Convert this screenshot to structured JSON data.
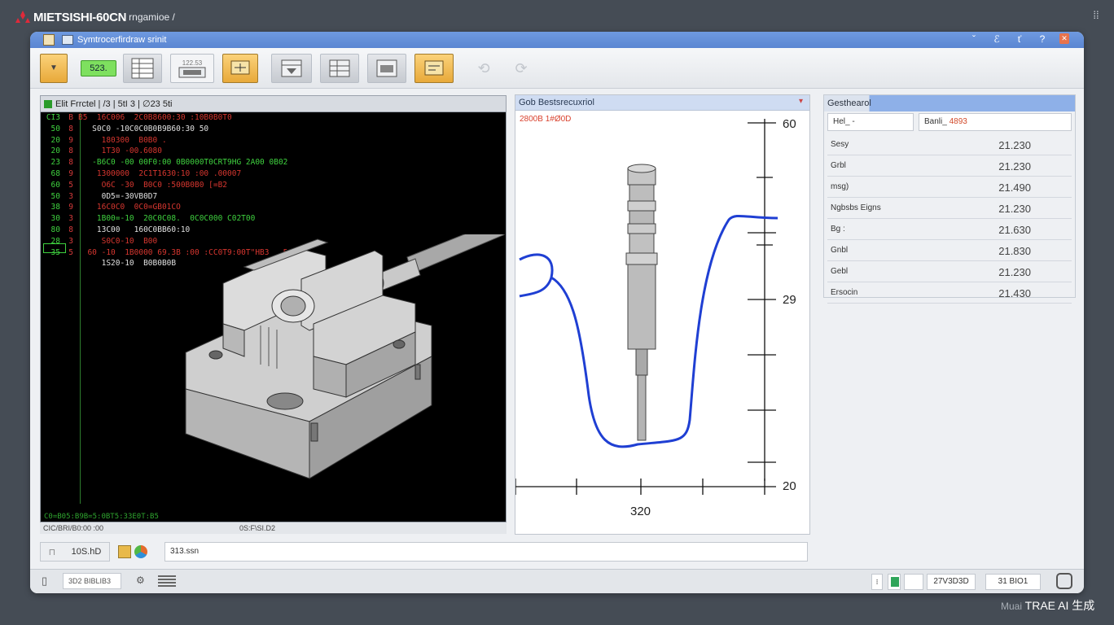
{
  "brand": {
    "name": "MIETSISHI-60CN",
    "suffix": "rngamioe /"
  },
  "window": {
    "title": "Symtrocerfirdraw srinit"
  },
  "toolbar": {
    "btn_dropdown": "▼",
    "btn_green": "523.",
    "btn_gauge": "122.53"
  },
  "code_panel": {
    "header": "Elit Frrctel | /3 | 5tI 3 | ∅23 5ti",
    "lines": [
      {
        "n1": "CI3",
        "n2": "B",
        "text": "B5  16C006  2C0B8600:30 :10B0B0T0"
      },
      {
        "n1": "50",
        "n2": "8",
        "text": "   S0C0 -10C0C0B0B9B60:30 50"
      },
      {
        "n1": "20",
        "n2": "9",
        "text": "     180300  B0B0 ."
      },
      {
        "n1": "20",
        "n2": "8",
        "text": "     1T30 -00.6080"
      },
      {
        "n1": "23",
        "n2": "8",
        "text": "   -B6C0 -00 00F0:00 0B0000T0CRT9HG 2A00 0B02"
      },
      {
        "n1": "68",
        "n2": "9",
        "text": "    1300000  2C1T1630:10 :00 .00007"
      },
      {
        "n1": "60",
        "n2": "5",
        "text": "     O6C -30  B0C0 :500B0B0 [=B2"
      },
      {
        "n1": "50",
        "n2": "3",
        "text": "     0D5=-30VB0D7"
      },
      {
        "n1": "38",
        "n2": "9",
        "text": "    16C0C0  0C0=GB01CO"
      },
      {
        "n1": "30",
        "n2": "3",
        "text": "    1B00=-10  20C0C08.  0C0C000 C02T00"
      },
      {
        "n1": "80",
        "n2": "8",
        "text": "    13C00   160C0BB60:10"
      },
      {
        "n1": "28",
        "n2": "3",
        "text": "     S0C0-10  B00"
      },
      {
        "n1": "35",
        "n2": "5",
        "text": "  60 -10  1B0000 69.3B :00 :CC0T9:00T\"HB3   5"
      },
      {
        "n1": "",
        "n2": "",
        "text": "     1S20-10  B0B0B0B"
      }
    ],
    "status": "C0=B05:B9B=5:0BT5:33E0T:B5",
    "footer_left": "CIC/BRI/B0:00 :00",
    "footer_right": "0S:F\\SI.D2"
  },
  "graph_panel": {
    "header": "Gob Bestsrecuxriol",
    "subtitle": "2800B 1#Ø0D",
    "y_tick_top": "60",
    "y_tick_mid": "29",
    "y_tick_bottom": "20",
    "x_label": "320",
    "curve_color": "#1f3fd3"
  },
  "table_panel": {
    "header": "Gesthearol",
    "input_left": "Hel_ -",
    "input_right_prefix": "Banli_",
    "input_right_accent": "4893",
    "rows": [
      {
        "key": "Sesy",
        "value": "21.230"
      },
      {
        "key": "Grbl",
        "value": "21.230"
      },
      {
        "key": "msg)",
        "value": "21.490"
      },
      {
        "key": "Ngbsbs Eigns",
        "value": "21.230"
      },
      {
        "key": "Bg :",
        "value": "21.630"
      },
      {
        "key": "Gnbl",
        "value": "21.830"
      },
      {
        "key": "Gebl",
        "value": "21.230"
      },
      {
        "key": "Ersocin",
        "value": "21.430"
      }
    ]
  },
  "cmd_bar": {
    "btn_label": "10S.hD",
    "input_value": "313.ssn"
  },
  "statusbar": {
    "field": "3D2 BIBLIB3",
    "coord1": "27V3D3D",
    "coord2": "31 BIO1"
  },
  "watermark": {
    "faint": "Muai",
    "main": "TRAE AI 生成"
  }
}
